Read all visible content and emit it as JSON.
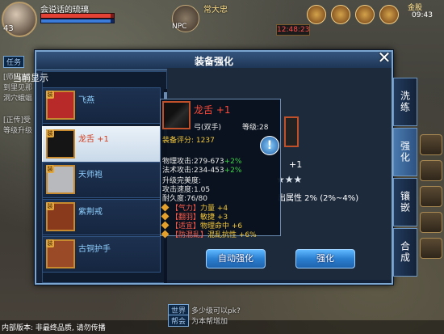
{
  "hud": {
    "player_level": "43",
    "player_name": "会说话的琉璃",
    "npc_label": "NPC",
    "npc_name": "常大忠",
    "timer": "12:48:23",
    "top_right_label": "金股",
    "clock": "09:43"
  },
  "left_chat": [
    {
      "tag": "任务",
      "text": ""
    },
    {
      "tag": "",
      "text": "[师门]巡"
    },
    {
      "tag": "",
      "text": "到里见那"
    },
    {
      "tag": "",
      "text": "洞穴蛾蝠"
    },
    {
      "tag": "",
      "text": "[正传]受"
    },
    {
      "tag": "",
      "text": "等级升级"
    }
  ],
  "bottom_chat": [
    {
      "tag": "世界",
      "text": "多少级可以pk?"
    },
    {
      "tag": "帮会",
      "text": "为本帮增加"
    }
  ],
  "bottom_text": "内部版本: 非最终品质, 请勿传播",
  "dialog": {
    "title": "装备强化",
    "close_label": "✕",
    "list_header": "当前显示",
    "items": [
      {
        "name": "飞燕",
        "badge": "装",
        "selected": false,
        "icon_color": "#b8292a"
      },
      {
        "name": "龙舌 +1",
        "badge": "装",
        "selected": true,
        "icon_color": "#151515"
      },
      {
        "name": "天师袍",
        "badge": "装",
        "selected": false,
        "icon_color": "#b7b9bd"
      },
      {
        "name": "紫荆戒",
        "badge": "装",
        "selected": false,
        "icon_color": "#8a3a1c"
      },
      {
        "name": "古铜护手",
        "badge": "装",
        "selected": false,
        "icon_color": "#9a4a26"
      }
    ],
    "tabs": [
      {
        "label": "洗练",
        "active": false
      },
      {
        "label": "强化",
        "active": true
      },
      {
        "label": "镶嵌",
        "active": false
      },
      {
        "label": "合成",
        "active": false
      }
    ],
    "plus_label": "+1",
    "stars": "★★★",
    "attr_text": "出属性  2% (2%~4%)",
    "buttons": {
      "auto": "自动强化",
      "enhance": "强化"
    }
  },
  "tooltip": {
    "name": "龙舌 +1",
    "type": "弓(双手)",
    "level": "等级:28",
    "score_label": "装备评分:",
    "score": "1237",
    "phys_attack": "物理攻击:279-673",
    "phys_bonus": "+2%",
    "magic_attack": "法术攻击:234-453",
    "magic_bonus": "+2%",
    "quality": "升级完美度:",
    "speed": "攻击速度:1.05",
    "durability": "耐久度:76/80",
    "gems": [
      {
        "slot": "【气力】",
        "attr": "力量 +4"
      },
      {
        "slot": "【翻羽】",
        "attr": "敏捷 +3"
      },
      {
        "slot": "【适宜】",
        "attr": "物理命中 +6"
      },
      {
        "slot": "【防混乱】",
        "attr": "混乱抗性 +6%"
      }
    ]
  },
  "colors": {
    "accent": "#5fb8ff",
    "dialog_bg": "#1a2c48",
    "item_red": "#ff4a3a",
    "green_bonus": "#3fd34a"
  },
  "icons": [
    "close-icon",
    "info-icon",
    "gem-icon",
    "star-icon"
  ]
}
